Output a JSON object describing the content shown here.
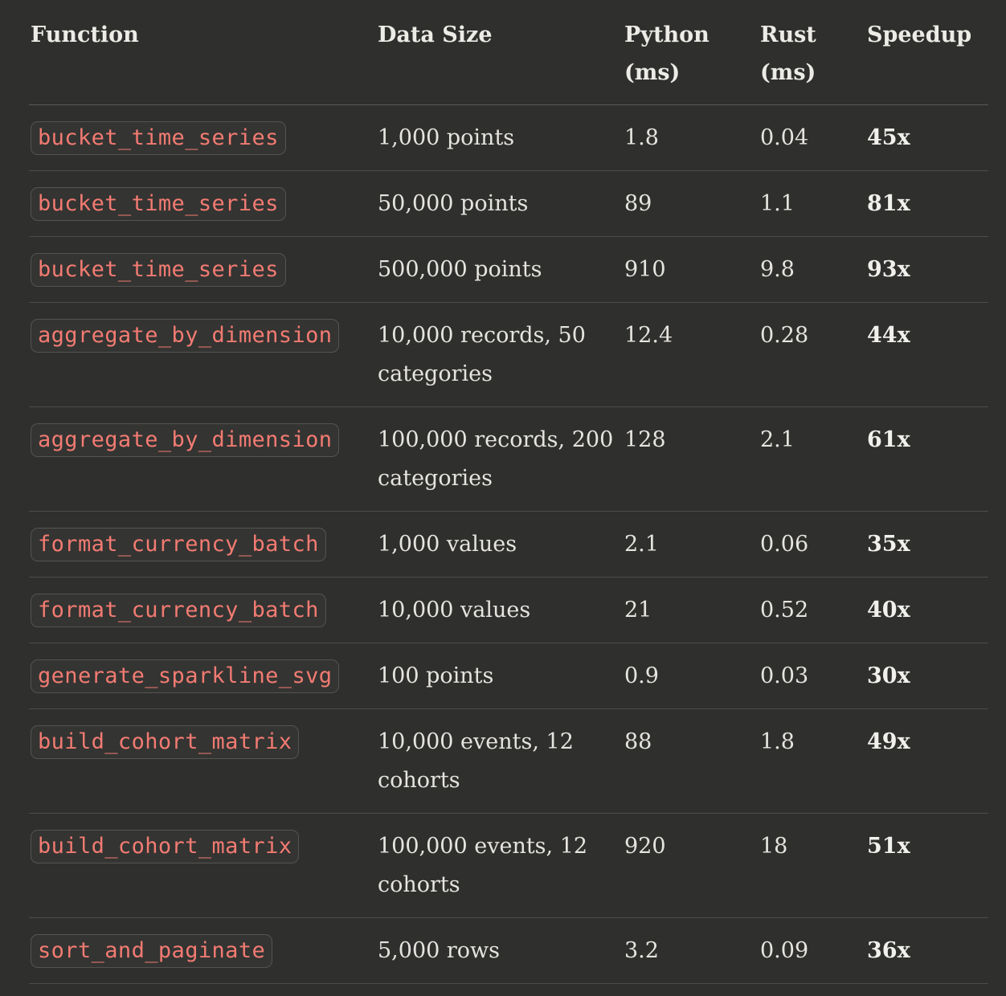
{
  "table": {
    "headers": {
      "function": "Function",
      "data_size": "Data Size",
      "python": "Python (ms)",
      "rust": "Rust (ms)",
      "speedup": "Speedup"
    },
    "rows": [
      {
        "function": "bucket_time_series",
        "data_size": "1,000 points",
        "python": "1.8",
        "rust": "0.04",
        "speedup": "45x"
      },
      {
        "function": "bucket_time_series",
        "data_size": "50,000 points",
        "python": "89",
        "rust": "1.1",
        "speedup": "81x"
      },
      {
        "function": "bucket_time_series",
        "data_size": "500,000 points",
        "python": "910",
        "rust": "9.8",
        "speedup": "93x"
      },
      {
        "function": "aggregate_by_dimension",
        "data_size": "10,000 records, 50 categories",
        "python": "12.4",
        "rust": "0.28",
        "speedup": "44x"
      },
      {
        "function": "aggregate_by_dimension",
        "data_size": "100,000 records, 200 categories",
        "python": "128",
        "rust": "2.1",
        "speedup": "61x"
      },
      {
        "function": "format_currency_batch",
        "data_size": "1,000 values",
        "python": "2.1",
        "rust": "0.06",
        "speedup": "35x"
      },
      {
        "function": "format_currency_batch",
        "data_size": "10,000 values",
        "python": "21",
        "rust": "0.52",
        "speedup": "40x"
      },
      {
        "function": "generate_sparkline_svg",
        "data_size": "100 points",
        "python": "0.9",
        "rust": "0.03",
        "speedup": "30x"
      },
      {
        "function": "build_cohort_matrix",
        "data_size": "10,000 events, 12 cohorts",
        "python": "88",
        "rust": "1.8",
        "speedup": "49x"
      },
      {
        "function": "build_cohort_matrix",
        "data_size": "100,000 events, 12 cohorts",
        "python": "920",
        "rust": "18",
        "speedup": "51x"
      },
      {
        "function": "sort_and_paginate",
        "data_size": "5,000 rows",
        "python": "3.2",
        "rust": "0.09",
        "speedup": "36x"
      }
    ]
  },
  "colors": {
    "background": "#2f2f2d",
    "code_text": "#f27b72",
    "code_background": "#343432",
    "text": "#e6e4df"
  }
}
